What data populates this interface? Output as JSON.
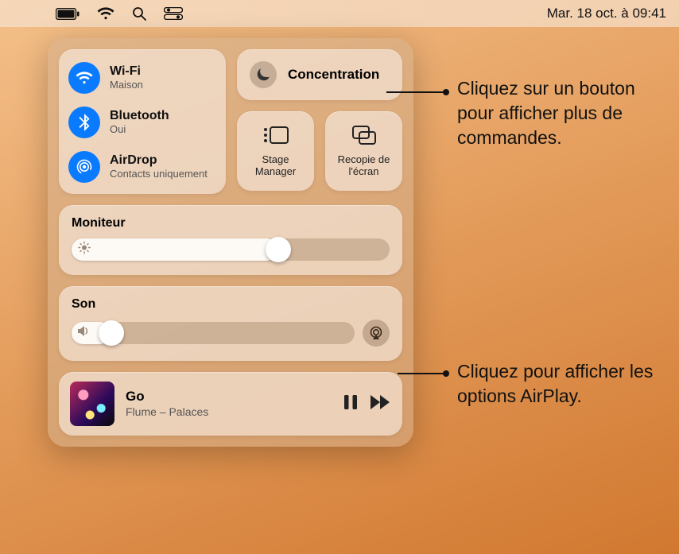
{
  "menubar": {
    "date": "Mar. 18 oct. à 09:41"
  },
  "connectivity": {
    "wifi": {
      "title": "Wi-Fi",
      "sub": "Maison"
    },
    "bluetooth": {
      "title": "Bluetooth",
      "sub": "Oui"
    },
    "airdrop": {
      "title": "AirDrop",
      "sub": "Contacts uniquement"
    }
  },
  "focus": {
    "label": "Concentration"
  },
  "mini": {
    "stage": {
      "label": "Stage Manager"
    },
    "mirror": {
      "label": "Recopie de l'écran"
    }
  },
  "display": {
    "title": "Moniteur",
    "value_pct": 65
  },
  "sound": {
    "title": "Son",
    "value_pct": 14
  },
  "now_playing": {
    "track": "Go",
    "artist": "Flume – Palaces"
  },
  "callouts": {
    "focus": "Cliquez sur un bouton pour afficher plus de commandes.",
    "airplay": "Cliquez pour afficher les options AirPlay."
  }
}
